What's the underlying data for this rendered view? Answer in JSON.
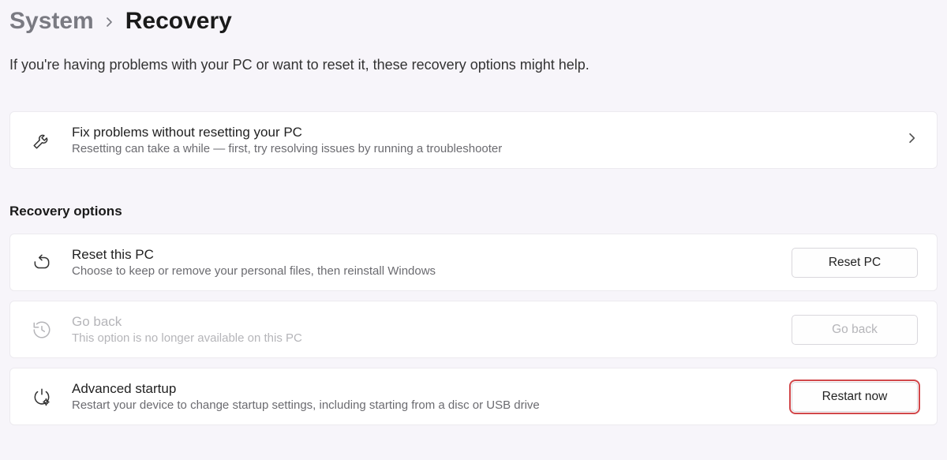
{
  "breadcrumb": {
    "parent": "System",
    "current": "Recovery"
  },
  "intro": "If you're having problems with your PC or want to reset it, these recovery options might help.",
  "fix_card": {
    "title": "Fix problems without resetting your PC",
    "sub": "Resetting can take a while — first, try resolving issues by running a troubleshooter"
  },
  "section_heading": "Recovery options",
  "reset_card": {
    "title": "Reset this PC",
    "sub": "Choose to keep or remove your personal files, then reinstall Windows",
    "button": "Reset PC"
  },
  "goback_card": {
    "title": "Go back",
    "sub": "This option is no longer available on this PC",
    "button": "Go back"
  },
  "advanced_card": {
    "title": "Advanced startup",
    "sub": "Restart your device to change startup settings, including starting from a disc or USB drive",
    "button": "Restart now"
  }
}
